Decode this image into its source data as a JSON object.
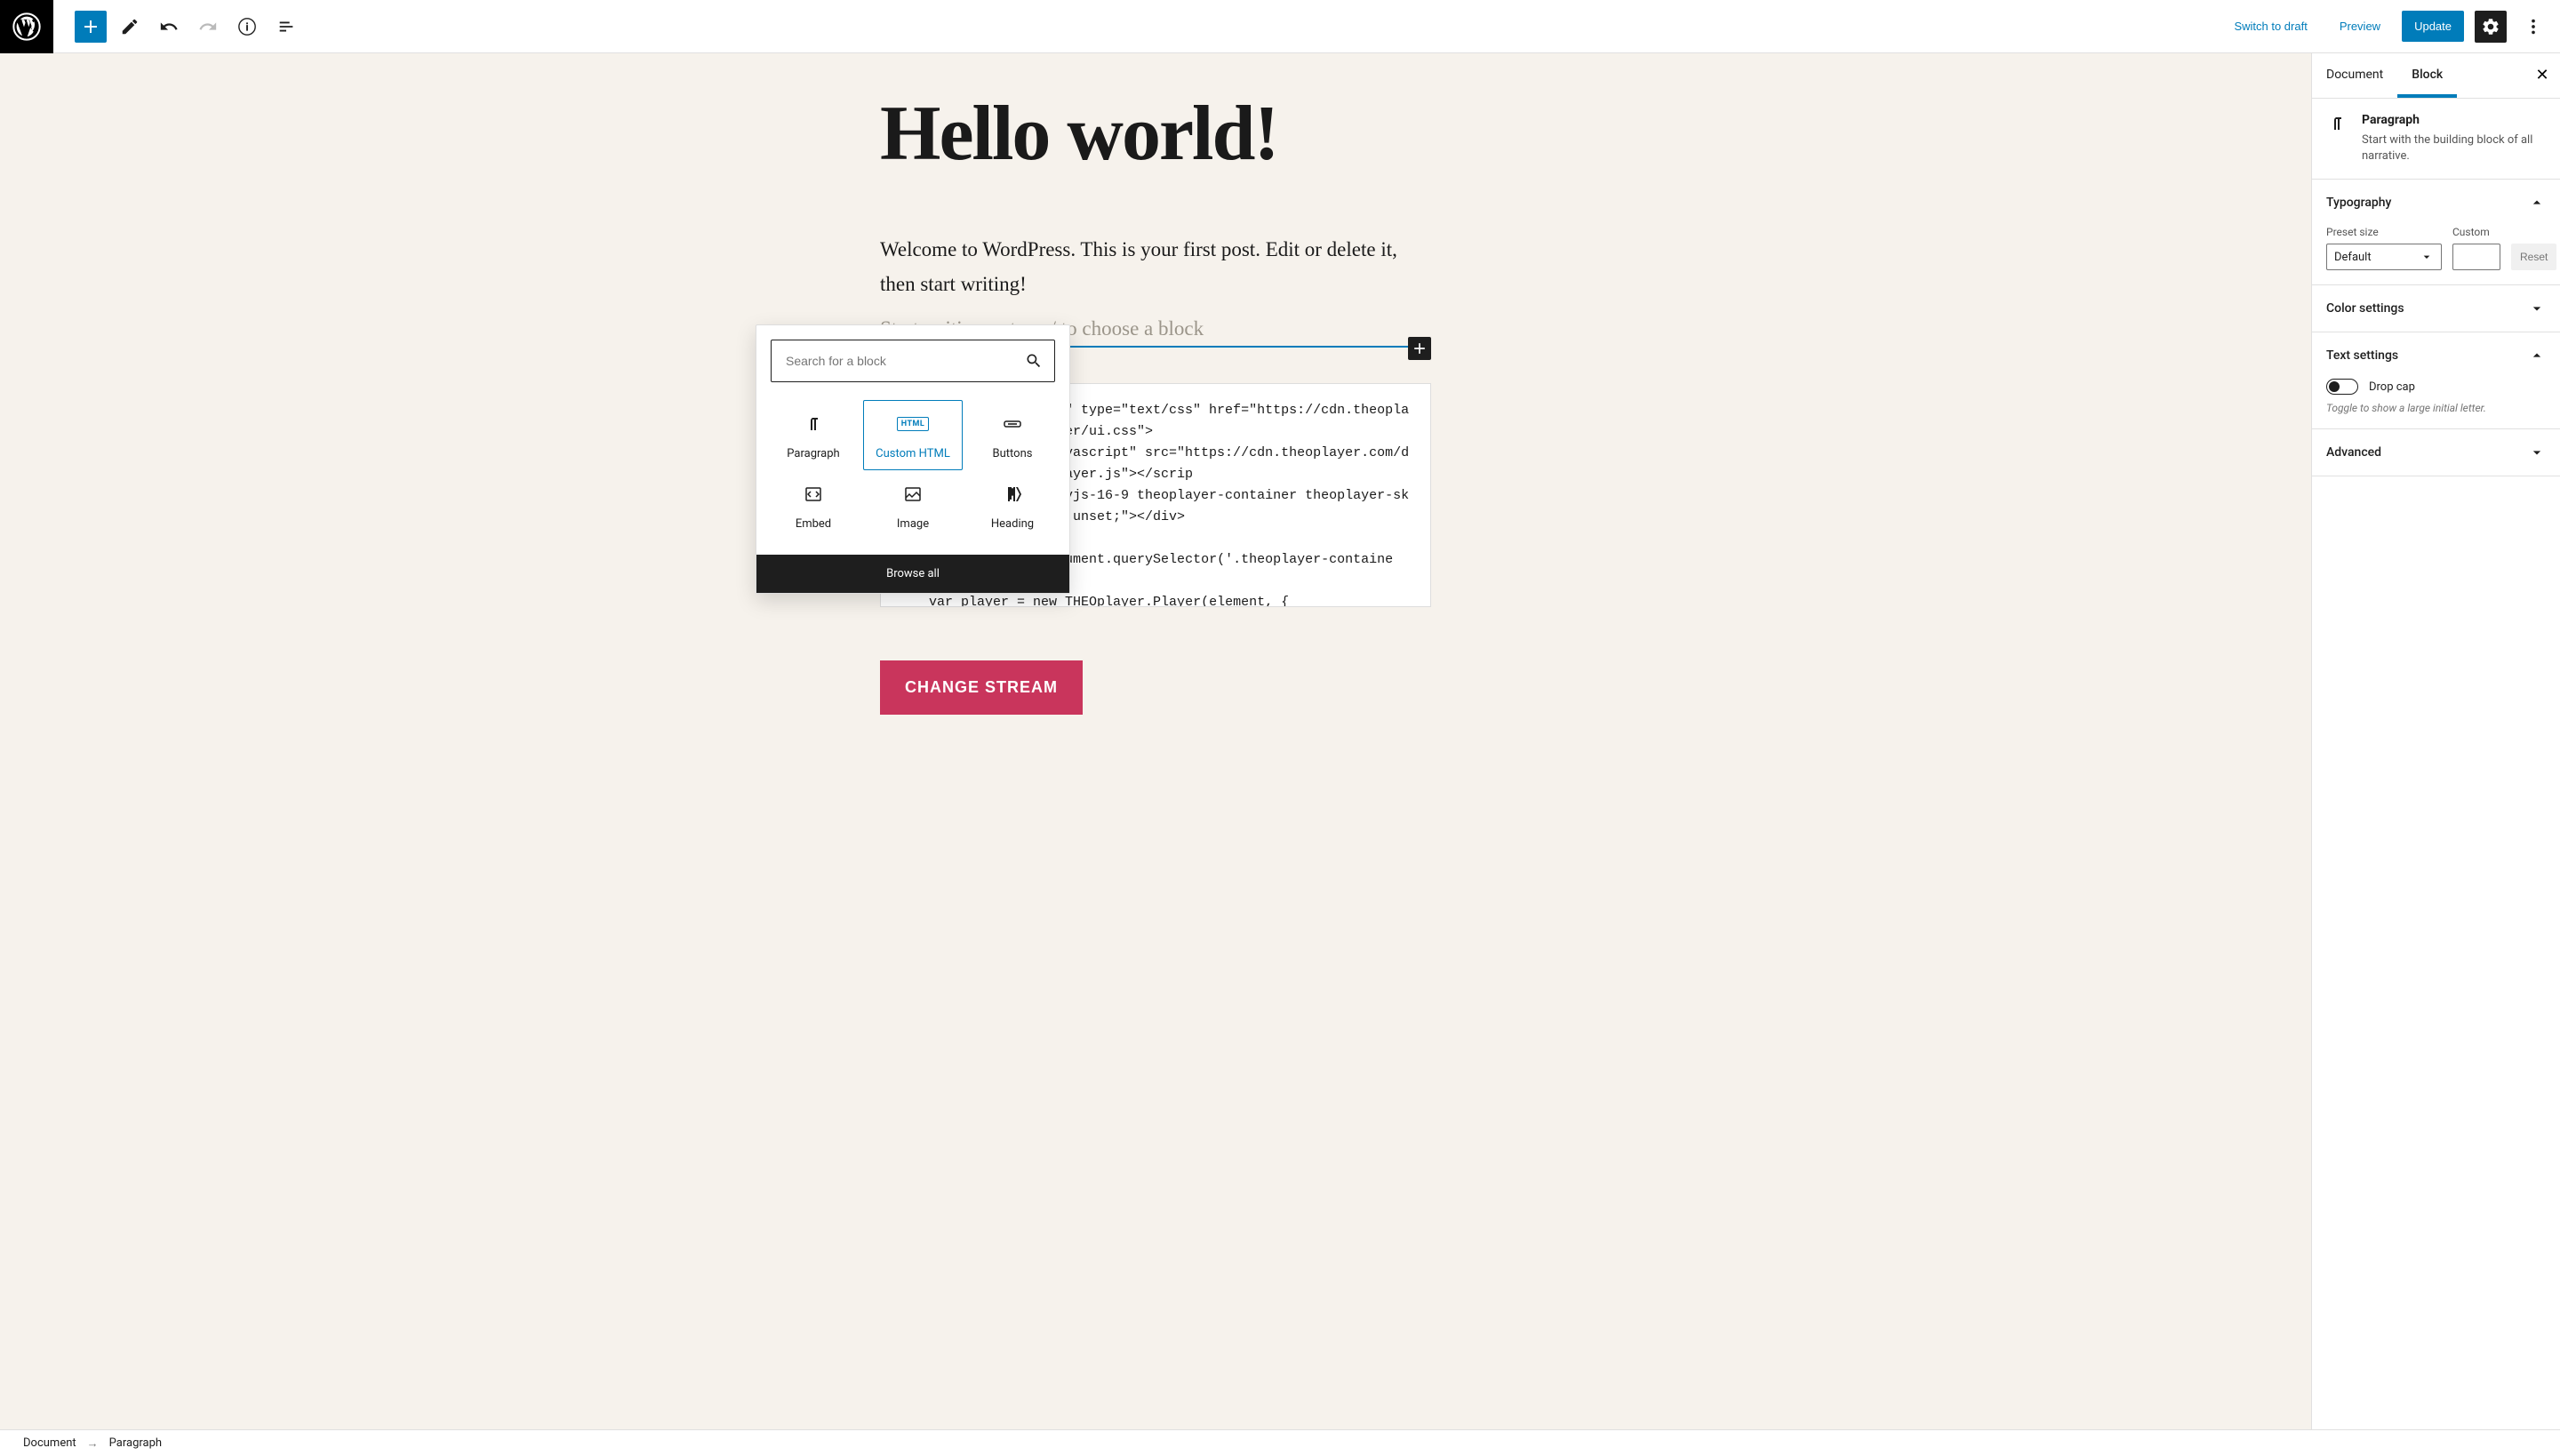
{
  "toolbar": {
    "switch_to_draft": "Switch to draft",
    "preview": "Preview",
    "update": "Update"
  },
  "editor": {
    "title": "Hello world!",
    "intro": "Welcome to WordPress. This is your first post. Edit or delete it, then start writing!",
    "placeholder": "Start writing or type / to choose a block",
    "code": "<link rel=\"stylesheet\" type=\"text/css\" href=\"https://cdn.theoplayer.com/dash/theoplayer/ui.css\">\n<script type=\"text/javascript\" src=\"https://cdn.theoplayer.com/dash/theoplayer/THEOplayer.js\"></scrip\n<div class=\"video-js vjs-16-9 theoplayer-container theoplayer-skin\" style=\"max-width: unset;\"></div>\n<script>\n    var element = document.querySelector('.theoplayer-container');\n    var player = new THEOplayer.Player(element, {\n        libraryLocation : 'https://cdn.theoplayer.com/dash/theoplayer/",
    "button_label": "CHANGE STREAM"
  },
  "inserter": {
    "search_placeholder": "Search for a block",
    "items": [
      {
        "label": "Paragraph"
      },
      {
        "label": "Custom HTML"
      },
      {
        "label": "Buttons"
      },
      {
        "label": "Embed"
      },
      {
        "label": "Image"
      },
      {
        "label": "Heading"
      }
    ],
    "browse_all": "Browse all"
  },
  "sidebar": {
    "tabs": {
      "document": "Document",
      "block": "Block"
    },
    "block": {
      "name": "Paragraph",
      "description": "Start with the building block of all narrative."
    },
    "typography": {
      "title": "Typography",
      "preset_label": "Preset size",
      "preset_value": "Default",
      "custom_label": "Custom",
      "custom_value": "",
      "reset": "Reset"
    },
    "color": {
      "title": "Color settings"
    },
    "text": {
      "title": "Text settings",
      "drop_cap_label": "Drop cap",
      "drop_cap_help": "Toggle to show a large initial letter."
    },
    "advanced": {
      "title": "Advanced"
    }
  },
  "breadcrumb": {
    "root": "Document",
    "leaf": "Paragraph"
  }
}
